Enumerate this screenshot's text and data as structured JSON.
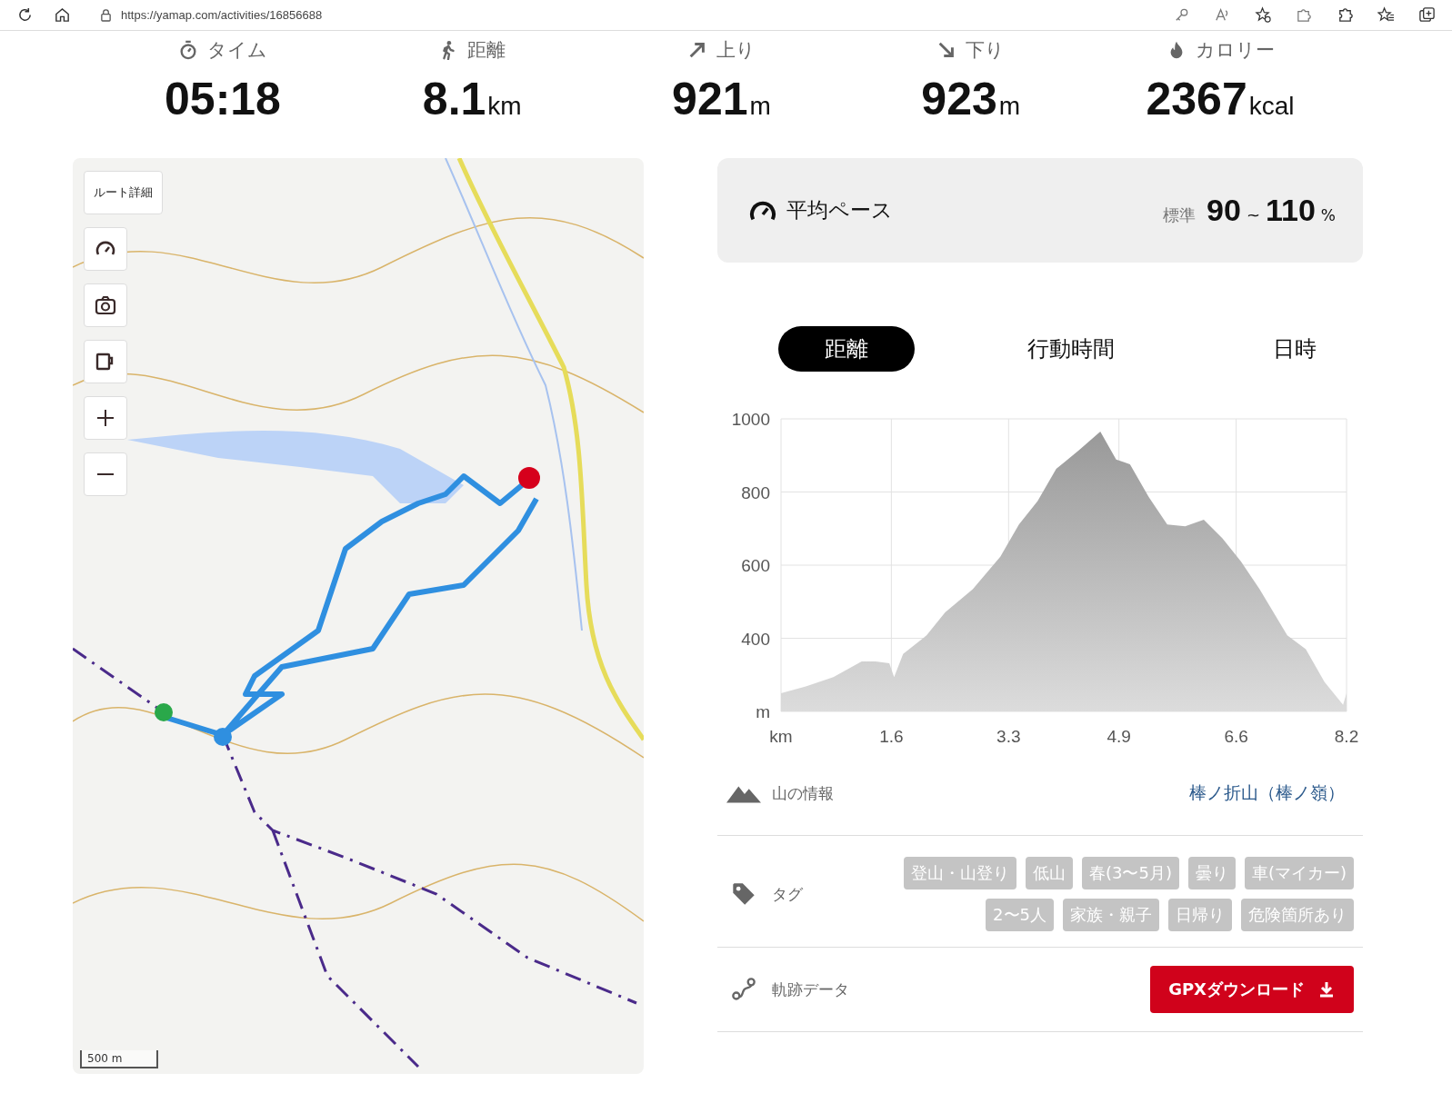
{
  "browser": {
    "url": "https://yamap.com/activities/16856688"
  },
  "stats": [
    {
      "kind": "time",
      "label": "タイム",
      "value": "05:18"
    },
    {
      "kind": "distance",
      "label": "距離",
      "value": "8.1",
      "unit": "km"
    },
    {
      "kind": "up",
      "label": "上り",
      "value": "921",
      "unit": "m"
    },
    {
      "kind": "down",
      "label": "下り",
      "value": "923",
      "unit": "m"
    },
    {
      "kind": "calorie",
      "label": "カロリー",
      "value": "2367",
      "unit": "kcal"
    }
  ],
  "map": {
    "kind": "picture",
    "route_button": "ルート詳細",
    "scale": "500 m"
  },
  "pace": {
    "label": "平均ペース",
    "standard_label": "標準",
    "min": "90",
    "separator": "~",
    "max": "110",
    "unit": "%"
  },
  "chart_tabs": [
    {
      "label": "距離",
      "selected": true
    },
    {
      "label": "行動時間",
      "selected": false
    },
    {
      "label": "日時",
      "selected": false
    }
  ],
  "elevation": {
    "chart_data": {
      "type": "area",
      "xlim": [
        0,
        8.2
      ],
      "ylim": [
        200,
        1000
      ],
      "xticks": [
        {
          "value": 0,
          "label": "km"
        },
        1.6,
        3.3,
        4.9,
        6.6,
        8.2
      ],
      "yticks": [
        {
          "value": 200,
          "label": "m"
        },
        400,
        600,
        800,
        1000
      ],
      "x": [
        0,
        0.36,
        0.76,
        1.17,
        1.37,
        1.57,
        1.64,
        1.77,
        2.11,
        2.38,
        2.78,
        3.18,
        3.45,
        3.72,
        3.99,
        4.32,
        4.63,
        4.86,
        5.06,
        5.33,
        5.6,
        5.86,
        6.13,
        6.4,
        6.67,
        6.94,
        7.34,
        7.61,
        7.88,
        8.15,
        8.2
      ],
      "grid": true,
      "series": [
        {
          "color": "#999999",
          "values": [
            250,
            268,
            294,
            337,
            337,
            332,
            294,
            357,
            408,
            471,
            534,
            623,
            711,
            775,
            863,
            914,
            965,
            889,
            876,
            787,
            711,
            706,
            724,
            673,
            610,
            534,
            408,
            370,
            281,
            218,
            250
          ]
        }
      ]
    }
  },
  "mountain": {
    "label": "山の情報",
    "link": "棒ノ折山（棒ノ嶺）"
  },
  "tags": {
    "label": "タグ",
    "items": [
      "登山・山登り",
      "低山",
      "春(3〜5月)",
      "曇り",
      "車(マイカー)",
      "2〜5人",
      "家族・親子",
      "日帰り",
      "危険箇所あり"
    ]
  },
  "track": {
    "label": "軌跡データ",
    "button": "GPXダウンロード"
  }
}
